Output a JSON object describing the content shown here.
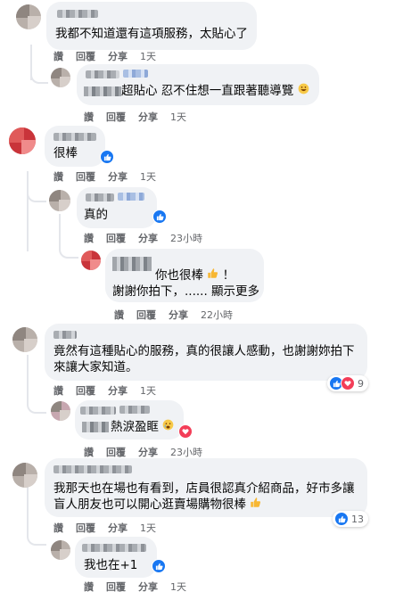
{
  "comments": [
    {
      "id": "c1",
      "text": "我都不知道還有這項服務，太貼心了",
      "actions": [
        "讚",
        "回覆",
        "分享",
        "1天"
      ]
    },
    {
      "id": "c1r1",
      "text": "超貼心 忍不住想一直跟著聽導覽",
      "emoji": "grin-emoji",
      "actions": [
        "讚",
        "回覆",
        "分享",
        "1天"
      ]
    },
    {
      "id": "c2",
      "text": "很棒",
      "actions": [
        "讚",
        "回覆",
        "分享",
        "1天"
      ]
    },
    {
      "id": "c2r1",
      "text": "真的",
      "actions": [
        "讚",
        "回覆",
        "分享",
        "23小時"
      ]
    },
    {
      "id": "c2r2",
      "line1": "你也很棒",
      "line1_end": "！",
      "line2": "謝謝你拍下，...... 顯示更多",
      "actions": [
        "讚",
        "回覆",
        "分享",
        "22小時"
      ]
    },
    {
      "id": "c3",
      "line1": "竟然有這種貼心的服務，真的很讓人感動，也謝謝妳拍下",
      "line2": "來讓大家知道。",
      "reactions_count": "9",
      "actions": [
        "讚",
        "回覆",
        "分享",
        "1天"
      ]
    },
    {
      "id": "c3r1",
      "text": "熱淚盈眶",
      "actions": [
        "讚",
        "回覆",
        "分享",
        "23小時"
      ]
    },
    {
      "id": "c4",
      "line1": "我那天也在場也有看到，店員很認真介紹商品，好市多讓",
      "line2": "盲人朋友也可以開心逛賣場購物很棒",
      "reactions_count": "13",
      "actions": [
        "讚",
        "回覆",
        "分享",
        "1天"
      ]
    },
    {
      "id": "c4r1",
      "text": "我也在+1",
      "actions": [
        "讚",
        "回覆",
        "分享",
        "1天"
      ]
    }
  ],
  "colors": {
    "bubble": "#f0f2f5",
    "like_blue": "#1877f2",
    "love_red": "#f33e58",
    "meta_gray": "#65676b"
  }
}
